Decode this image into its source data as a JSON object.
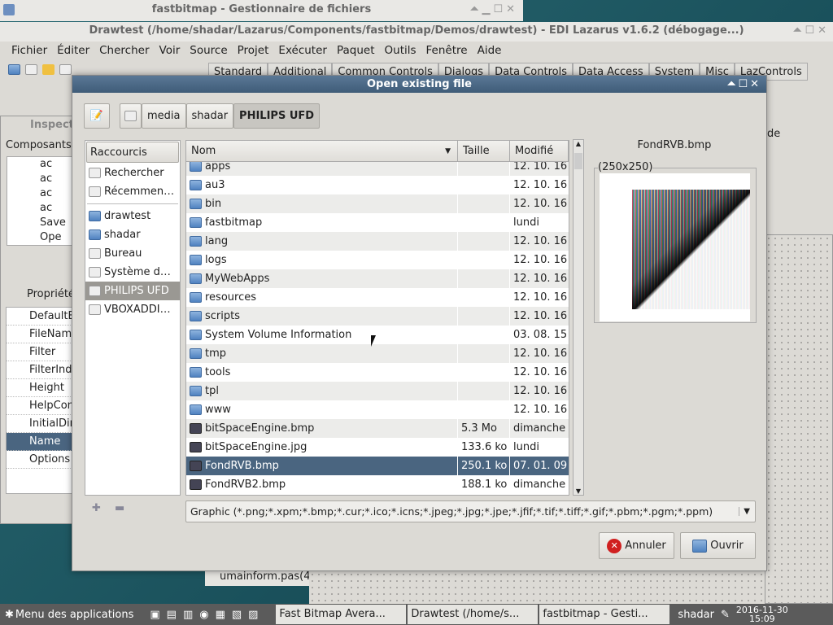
{
  "file_manager": {
    "title": "fastbitmap - Gestionnaire de fichiers"
  },
  "lazarus": {
    "title": "Drawtest (/home/shadar/Lazarus/Components/fastbitmap/Demos/drawtest) - EDI Lazarus v1.6.2 (débogage...)",
    "menu": [
      "Fichier",
      "Éditer",
      "Chercher",
      "Voir",
      "Source",
      "Projet",
      "Exécuter",
      "Paquet",
      "Outils",
      "Fenêtre",
      "Aide"
    ],
    "palette_tabs": [
      "Standard",
      "Additional",
      "Common Controls",
      "Dialogs",
      "Data Controls",
      "Data Access",
      "System",
      "Misc",
      "LazControls"
    ]
  },
  "inspector": {
    "title": "Inspect",
    "components_label": "Composants",
    "tree": [
      "ac",
      "ac",
      "ac",
      "ac",
      "Save",
      "Ope"
    ],
    "tab": "Propriété",
    "properties": [
      "DefaultEx",
      "FileName",
      "Filter",
      "FilterInde",
      "Height",
      "HelpCont",
      "InitialDir",
      "Name",
      "Options"
    ],
    "selected_property": "Name"
  },
  "editor_tab": "umainform.pas(4",
  "right_panel": {
    "label": "de"
  },
  "dialog": {
    "title": "Open existing file",
    "path": [
      "media",
      "shadar",
      "PHILIPS UFD"
    ],
    "shortcuts_header": "Raccourcis",
    "shortcuts": [
      {
        "label": "Rechercher",
        "icon": "search-icon"
      },
      {
        "label": "Récemmen…",
        "icon": "recent-icon"
      },
      {
        "label": "drawtest",
        "icon": "folder-icon"
      },
      {
        "label": "shadar",
        "icon": "home-folder-icon"
      },
      {
        "label": "Bureau",
        "icon": "desktop-icon"
      },
      {
        "label": "Système d…",
        "icon": "drive-icon"
      },
      {
        "label": "PHILIPS UFD",
        "icon": "usb-drive-icon",
        "selected": true
      },
      {
        "label": "VBOXADDI…",
        "icon": "cdrom-icon"
      }
    ],
    "columns": [
      "Nom",
      "Taille",
      "Modifié"
    ],
    "files": [
      {
        "name": "apps",
        "size": "",
        "date": "12. 10. 16",
        "type": "folder"
      },
      {
        "name": "au3",
        "size": "",
        "date": "12. 10. 16",
        "type": "folder"
      },
      {
        "name": "bin",
        "size": "",
        "date": "12. 10. 16",
        "type": "folder"
      },
      {
        "name": "fastbitmap",
        "size": "",
        "date": "lundi",
        "type": "folder"
      },
      {
        "name": "lang",
        "size": "",
        "date": "12. 10. 16",
        "type": "folder"
      },
      {
        "name": "logs",
        "size": "",
        "date": "12. 10. 16",
        "type": "folder"
      },
      {
        "name": "MyWebApps",
        "size": "",
        "date": "12. 10. 16",
        "type": "folder"
      },
      {
        "name": "resources",
        "size": "",
        "date": "12. 10. 16",
        "type": "folder"
      },
      {
        "name": "scripts",
        "size": "",
        "date": "12. 10. 16",
        "type": "folder"
      },
      {
        "name": "System Volume Information",
        "size": "",
        "date": "03. 08. 15",
        "type": "folder"
      },
      {
        "name": "tmp",
        "size": "",
        "date": "12. 10. 16",
        "type": "folder"
      },
      {
        "name": "tools",
        "size": "",
        "date": "12. 10. 16",
        "type": "folder"
      },
      {
        "name": "tpl",
        "size": "",
        "date": "12. 10. 16",
        "type": "folder"
      },
      {
        "name": "www",
        "size": "",
        "date": "12. 10. 16",
        "type": "folder"
      },
      {
        "name": "bitSpaceEngine.bmp",
        "size": "5.3 Mo",
        "date": "dimanche",
        "type": "image"
      },
      {
        "name": "bitSpaceEngine.jpg",
        "size": "133.6 ko",
        "date": "lundi",
        "type": "image"
      },
      {
        "name": "FondRVB.bmp",
        "size": "250.1 ko",
        "date": "07. 01. 09",
        "type": "image",
        "selected": true
      },
      {
        "name": "FondRVB2.bmp",
        "size": "188.1 ko",
        "date": "dimanche",
        "type": "image"
      }
    ],
    "preview": {
      "filename": "FondRVB.bmp",
      "dimensions": "(250x250)"
    },
    "filter": "Graphic (*.png;*.xpm;*.bmp;*.cur;*.ico;*.icns;*.jpeg;*.jpg;*.jpe;*.jfif;*.tif;*.tiff;*.gif;*.pbm;*.pgm;*.ppm)",
    "cancel_label": "Annuler",
    "open_label": "Ouvrir"
  },
  "taskbar": {
    "menu": "Menu des applications",
    "windows": [
      "Fast Bitmap Avera...",
      "Drawtest (/home/s...",
      "fastbitmap - Gesti..."
    ],
    "user": "shadar",
    "date": "2016-11-30",
    "time": "15:09"
  },
  "colors": {
    "selection": "#4a6580",
    "dialog_title": "#4a6784",
    "taskbar": "#5b5b5b"
  }
}
